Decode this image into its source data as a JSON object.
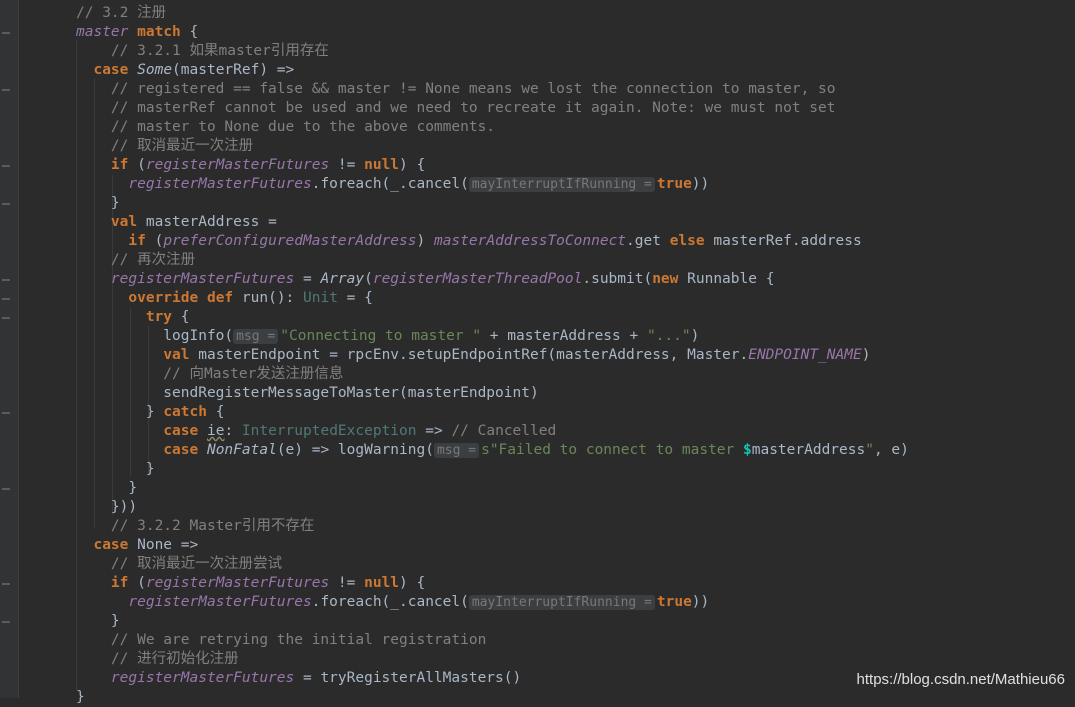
{
  "lines": [
    {
      "segs": [
        {
          "t": "// 3.2 注册",
          "c": "cm"
        }
      ]
    },
    {
      "segs": [
        {
          "t": "master",
          "c": "it"
        },
        {
          "t": " "
        },
        {
          "t": "match",
          "c": "kw"
        },
        {
          "t": " {"
        }
      ]
    },
    {
      "segs": [
        {
          "t": "    // 3.2.1 如果master引用存在",
          "c": "cm"
        }
      ]
    },
    {
      "segs": [
        {
          "t": "  "
        },
        {
          "t": "case",
          "c": "kw"
        },
        {
          "t": " "
        },
        {
          "t": "Some",
          "c": "ty"
        },
        {
          "t": "(masterRef) =>"
        }
      ]
    },
    {
      "segs": [
        {
          "t": "    // registered == false && master != None means we lost the connection to master, so",
          "c": "cm"
        }
      ]
    },
    {
      "segs": [
        {
          "t": "    // masterRef cannot be used and we need to recreate it again. Note: we must not set",
          "c": "cm"
        }
      ]
    },
    {
      "segs": [
        {
          "t": "    // master to None due to the above comments.",
          "c": "cm"
        }
      ]
    },
    {
      "segs": [
        {
          "t": "    // 取消最近一次注册",
          "c": "cm"
        }
      ]
    },
    {
      "segs": [
        {
          "t": "    "
        },
        {
          "t": "if",
          "c": "kw"
        },
        {
          "t": " ("
        },
        {
          "t": "registerMasterFutures",
          "c": "it"
        },
        {
          "t": " != "
        },
        {
          "t": "null",
          "c": "kw"
        },
        {
          "t": ") {"
        }
      ]
    },
    {
      "segs": [
        {
          "t": "      "
        },
        {
          "t": "registerMasterFutures",
          "c": "it"
        },
        {
          "t": ".foreach(_.cancel("
        },
        {
          "t": "mayInterruptIfRunning =",
          "c": "hint"
        },
        {
          "t": "true",
          "c": "kw"
        },
        {
          "t": "))"
        }
      ]
    },
    {
      "segs": [
        {
          "t": "    }"
        }
      ]
    },
    {
      "segs": [
        {
          "t": "    "
        },
        {
          "t": "val",
          "c": "kw"
        },
        {
          "t": " masterAddress ="
        }
      ]
    },
    {
      "segs": [
        {
          "t": "      "
        },
        {
          "t": "if",
          "c": "kw"
        },
        {
          "t": " ("
        },
        {
          "t": "preferConfiguredMasterAddress",
          "c": "it"
        },
        {
          "t": ") "
        },
        {
          "t": "masterAddressToConnect",
          "c": "it"
        },
        {
          "t": ".get "
        },
        {
          "t": "else",
          "c": "kw"
        },
        {
          "t": " masterRef.address"
        }
      ]
    },
    {
      "segs": [
        {
          "t": "    // 再次注册",
          "c": "cm"
        }
      ]
    },
    {
      "segs": [
        {
          "t": "    "
        },
        {
          "t": "registerMasterFutures",
          "c": "it"
        },
        {
          "t": " = "
        },
        {
          "t": "Array",
          "c": "ty"
        },
        {
          "t": "("
        },
        {
          "t": "registerMasterThreadPool",
          "c": "it"
        },
        {
          "t": ".submit("
        },
        {
          "t": "new",
          "c": "kw"
        },
        {
          "t": " Runnable {"
        }
      ]
    },
    {
      "segs": [
        {
          "t": "      "
        },
        {
          "t": "override",
          "c": "kw"
        },
        {
          "t": " "
        },
        {
          "t": "def",
          "c": "kw"
        },
        {
          "t": " run(): "
        },
        {
          "t": "Unit",
          "c": "tyc"
        },
        {
          "t": " = {"
        }
      ]
    },
    {
      "segs": [
        {
          "t": "        "
        },
        {
          "t": "try",
          "c": "kw"
        },
        {
          "t": " {"
        }
      ]
    },
    {
      "segs": [
        {
          "t": "          logInfo("
        },
        {
          "t": "msg =",
          "c": "hint"
        },
        {
          "t": "\"Connecting to master \"",
          "c": "str"
        },
        {
          "t": " + masterAddress + "
        },
        {
          "t": "\"...\"",
          "c": "str"
        },
        {
          "t": ")"
        }
      ]
    },
    {
      "segs": [
        {
          "t": "          "
        },
        {
          "t": "val",
          "c": "kw"
        },
        {
          "t": " masterEndpoint = rpcEnv.setupEndpointRef(masterAddress, Master."
        },
        {
          "t": "ENDPOINT_NAME",
          "c": "it"
        },
        {
          "t": ")"
        }
      ]
    },
    {
      "segs": [
        {
          "t": "          // 向Master发送注册信息",
          "c": "cm"
        }
      ]
    },
    {
      "segs": [
        {
          "t": "          sendRegisterMessageToMaster(masterEndpoint)"
        }
      ]
    },
    {
      "segs": [
        {
          "t": "        } "
        },
        {
          "t": "catch",
          "c": "kw"
        },
        {
          "t": " {"
        }
      ]
    },
    {
      "segs": [
        {
          "t": "          "
        },
        {
          "t": "case",
          "c": "kw"
        },
        {
          "t": " "
        },
        {
          "t": "ie",
          "c": "wavy"
        },
        {
          "t": ": "
        },
        {
          "t": "InterruptedException",
          "c": "tyc"
        },
        {
          "t": " => "
        },
        {
          "t": "// Cancelled",
          "c": "cm"
        }
      ]
    },
    {
      "segs": [
        {
          "t": "          "
        },
        {
          "t": "case",
          "c": "kw"
        },
        {
          "t": " "
        },
        {
          "t": "NonFatal",
          "c": "ty"
        },
        {
          "t": "(e) => logWarning("
        },
        {
          "t": "msg =",
          "c": "hint"
        },
        {
          "t": "s\"Failed to connect to master ",
          "c": "str"
        },
        {
          "t": "$",
          "c": "dollar"
        },
        {
          "t": "masterAddress"
        },
        {
          "t": "\"",
          "c": "str"
        },
        {
          "t": ", e)"
        }
      ]
    },
    {
      "segs": [
        {
          "t": "        }"
        }
      ]
    },
    {
      "segs": [
        {
          "t": "      }"
        }
      ]
    },
    {
      "segs": [
        {
          "t": "    }))"
        }
      ]
    },
    {
      "segs": [
        {
          "t": "    // 3.2.2 Master引用不存在",
          "c": "cm"
        }
      ]
    },
    {
      "segs": [
        {
          "t": "  "
        },
        {
          "t": "case",
          "c": "kw"
        },
        {
          "t": " None =>"
        }
      ]
    },
    {
      "segs": [
        {
          "t": "    // 取消最近一次注册尝试",
          "c": "cm"
        }
      ]
    },
    {
      "segs": [
        {
          "t": "    "
        },
        {
          "t": "if",
          "c": "kw"
        },
        {
          "t": " ("
        },
        {
          "t": "registerMasterFutures",
          "c": "it"
        },
        {
          "t": " != "
        },
        {
          "t": "null",
          "c": "kw"
        },
        {
          "t": ") {"
        }
      ]
    },
    {
      "segs": [
        {
          "t": "      "
        },
        {
          "t": "registerMasterFutures",
          "c": "it"
        },
        {
          "t": ".foreach(_.cancel("
        },
        {
          "t": "mayInterruptIfRunning =",
          "c": "hint"
        },
        {
          "t": "true",
          "c": "kw"
        },
        {
          "t": "))"
        }
      ]
    },
    {
      "segs": [
        {
          "t": "    }"
        }
      ]
    },
    {
      "segs": [
        {
          "t": "    // We are retrying the initial registration",
          "c": "cm"
        }
      ]
    },
    {
      "segs": [
        {
          "t": "    // 进行初始化注册",
          "c": "cm"
        }
      ]
    },
    {
      "segs": [
        {
          "t": "    "
        },
        {
          "t": "registerMasterFutures",
          "c": "it"
        },
        {
          "t": " = tryRegisterAllMasters()"
        }
      ]
    },
    {
      "segs": [
        {
          "t": "}"
        }
      ]
    }
  ],
  "watermark": "https://blog.csdn.net/Mathieu66"
}
